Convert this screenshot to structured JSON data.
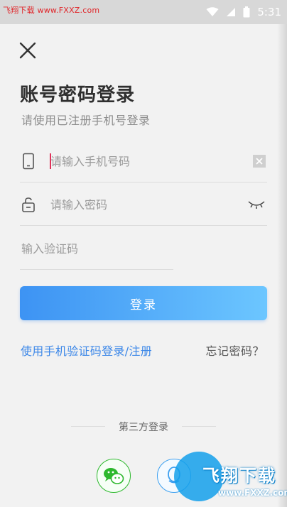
{
  "statusbar": {
    "watermark": "飞翔下载 www.FXXZ.com",
    "time": "5:31",
    "icons": [
      "wifi-icon",
      "signal-icon",
      "battery-icon"
    ]
  },
  "header": {
    "close_icon": "close-icon",
    "title": "账号密码登录",
    "subtitle": "请使用已注册手机号登录"
  },
  "form": {
    "phone": {
      "value": "",
      "placeholder": "请输入手机号码",
      "icon": "phone-icon",
      "action_icon": "clear-icon"
    },
    "password": {
      "value": "",
      "placeholder": "请输入密码",
      "icon": "lock-icon",
      "action_icon": "eye-closed-icon"
    },
    "code": {
      "value": "",
      "placeholder": "输入验证码"
    }
  },
  "login_button": "登录",
  "links": {
    "sms_login": "使用手机验证码登录/注册",
    "forgot": "忘记密码？"
  },
  "third_party": {
    "label": "第三方登录",
    "providers": [
      "wechat-icon",
      "qq-icon"
    ]
  },
  "watermark_logo": {
    "title": "飞翔下载",
    "url": "www.FXXZ.com"
  },
  "colors": {
    "accent_start": "#3d93f3",
    "accent_end": "#6cc6ff",
    "link": "#3a86e8",
    "wechat": "#2eb82e"
  }
}
